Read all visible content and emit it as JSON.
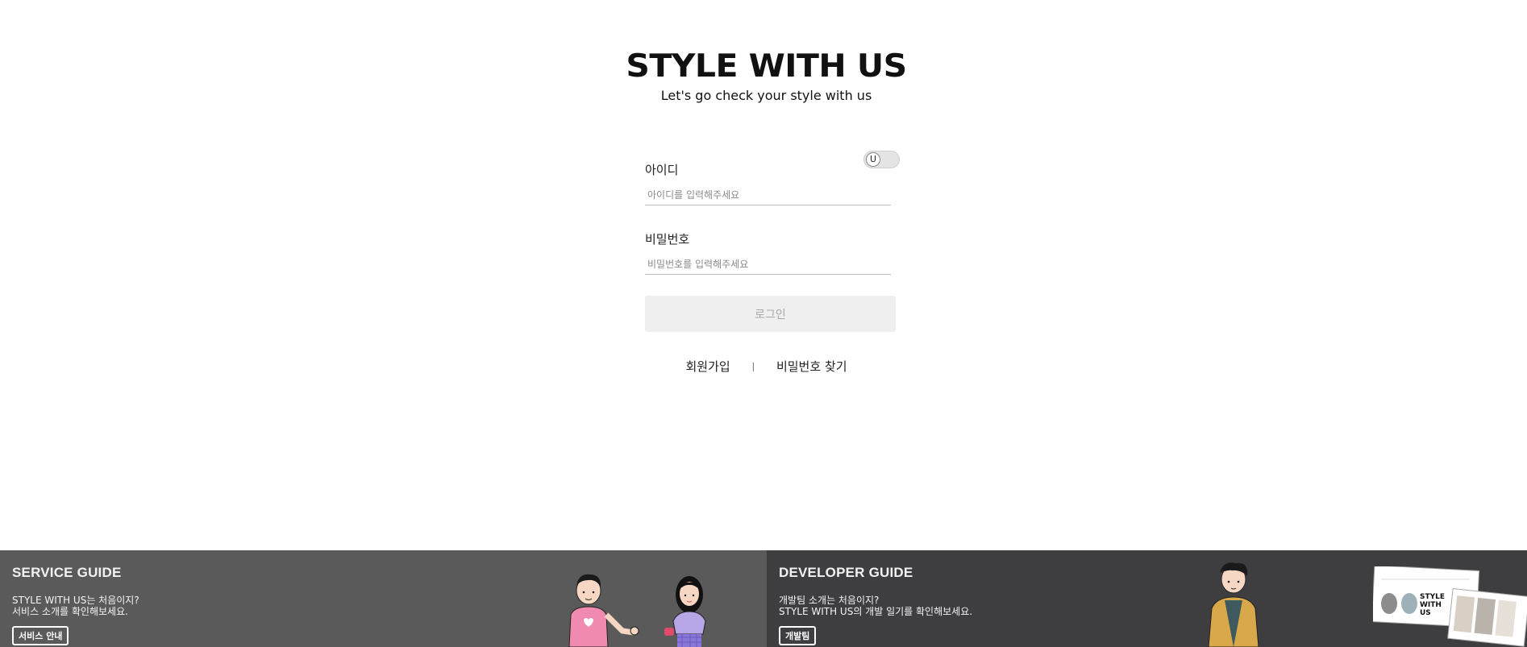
{
  "header": {
    "logo": "STYLE WITH US",
    "tagline": "Let's go check your style with us"
  },
  "login": {
    "toggle_label": "U",
    "id_label": "아이디",
    "id_placeholder": "아이디를 입력해주세요",
    "id_value": "",
    "password_label": "비밀번호",
    "password_placeholder": "비밀번호를 입력해주세요",
    "password_value": "",
    "submit_label": "로그인"
  },
  "links": {
    "signup": "회원가입",
    "separator": "|",
    "find_password": "비밀번호 찾기"
  },
  "service_guide": {
    "title": "SERVICE GUIDE",
    "line1": "STYLE WITH US는 처음이지?",
    "line2": "서비스 소개를 확인해보세요.",
    "button": "서비스 안내"
  },
  "developer_guide": {
    "title": "DEVELOPER GUIDE",
    "line1": "개발팀 소개는 처음이지?",
    "line2": "STYLE WITH US의 개발 일기를 확인해보세요.",
    "button": "개발팀",
    "preview_logo": "STYLE WITH US"
  },
  "colors": {
    "service_bg": "#5a5a5a",
    "developer_bg": "#3e3e40",
    "login_button_bg": "#efefef"
  }
}
